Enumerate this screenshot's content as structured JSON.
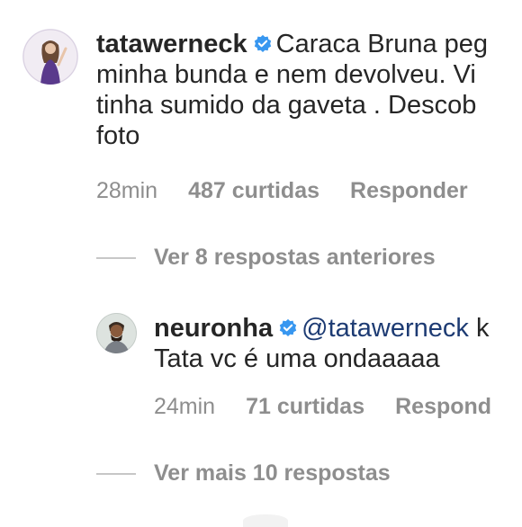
{
  "comment": {
    "username": "tatawerneck",
    "lines": [
      "Caraca Bruna peg",
      "minha bunda e nem devolveu. Vi",
      "tinha sumido da gaveta . Descob",
      "foto"
    ],
    "time": "28min",
    "likes": "487 curtidas",
    "reply_label": "Responder"
  },
  "view_previous": "Ver 8 respostas anteriores",
  "reply": {
    "username": "neuronha",
    "mention": "@tatawerneck",
    "first_line_tail": "k",
    "second_line": "Tata vc é uma ondaaaaa",
    "time": "24min",
    "likes": "71 curtidas",
    "reply_label": "Respond"
  },
  "view_more": "Ver mais 10 respostas",
  "colors": {
    "verified": "#3897f0",
    "mention": "#1d3b73",
    "muted": "#8e8e8e"
  },
  "icons": {
    "verified": "verified-badge-icon"
  }
}
